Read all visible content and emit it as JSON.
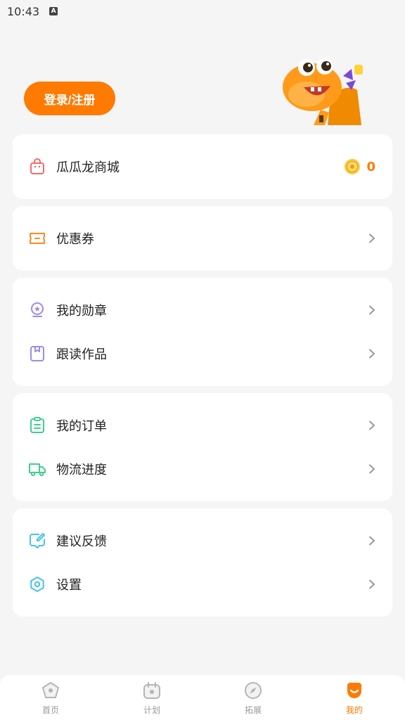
{
  "status_bar": {
    "time": "10:43",
    "notification_icon": "A"
  },
  "header": {
    "login_label": "登录/注册"
  },
  "shop": {
    "label": "瓜瓜龙商城",
    "coin_count": "0"
  },
  "menu": {
    "coupon": "优惠券",
    "badges": "我的勋章",
    "reading_works": "跟读作品",
    "orders": "我的订单",
    "logistics": "物流进度",
    "feedback": "建议反馈",
    "settings": "设置"
  },
  "tabs": [
    {
      "label": "首页",
      "icon": "home-icon"
    },
    {
      "label": "计划",
      "icon": "plan-icon"
    },
    {
      "label": "拓展",
      "icon": "compass-icon"
    },
    {
      "label": "我的",
      "icon": "profile-icon",
      "active": true
    }
  ],
  "colors": {
    "accent": "#ff7a00",
    "background": "#f5f5f5",
    "card": "#ffffff",
    "inactive_tab": "#9a9a9a"
  }
}
